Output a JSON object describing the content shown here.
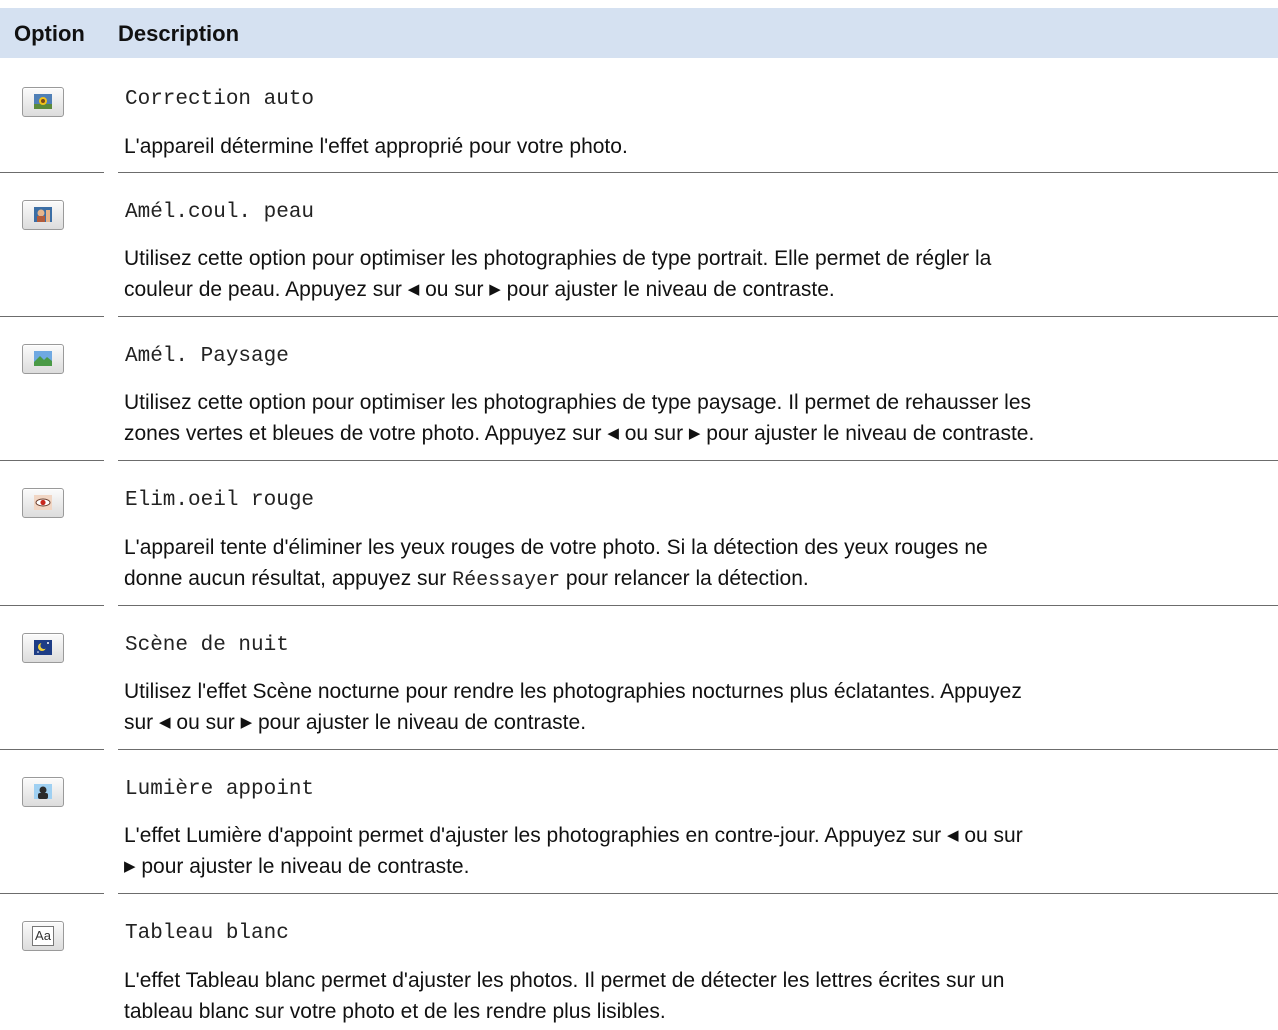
{
  "header": {
    "option": "Option",
    "description": "Description"
  },
  "rows": [
    {
      "icon": "sunflower-icon",
      "code": "Correction auto",
      "description": "L'appareil détermine l'effet approprié pour votre photo."
    },
    {
      "icon": "portrait-icon",
      "code": "Amél.coul. peau",
      "desc_line1": "Utilisez cette option pour optimiser les photographies de type portrait. Elle permet de régler la",
      "desc_line2_a": "couleur de peau. Appuyez sur ",
      "left_arrow": "◀",
      "desc_line2_b": " ou sur ",
      "right_arrow": "▶",
      "desc_line2_c": " pour ajuster le niveau de contraste."
    },
    {
      "icon": "landscape-icon",
      "code": "Amél. Paysage",
      "desc_line1": "Utilisez cette option pour optimiser les photographies de type paysage. Il permet de rehausser les",
      "desc_line2_a": "zones vertes et bleues de votre photo. Appuyez sur ",
      "left_arrow": "◀",
      "desc_line2_b": " ou sur ",
      "right_arrow": "▶",
      "desc_line2_c": " pour ajuster le niveau de contraste."
    },
    {
      "icon": "red-eye-icon",
      "code": "Elim.oeil rouge",
      "desc_line1": "L'appareil tente d'éliminer les yeux rouges de votre photo. Si la détection des yeux rouges ne",
      "desc_line2_a": "donne aucun résultat, appuyez sur ",
      "retry": "Réessayer",
      "desc_line2_b": " pour relancer la détection."
    },
    {
      "icon": "night-scene-icon",
      "code": "Scène de nuit",
      "desc_line1": "Utilisez l'effet Scène nocturne pour rendre les photographies nocturnes plus éclatantes. Appuyez",
      "desc_line2_a": "sur ",
      "left_arrow": "◀",
      "desc_line2_b": " ou sur ",
      "right_arrow": "▶",
      "desc_line2_c": " pour ajuster le niveau de contraste."
    },
    {
      "icon": "backlight-icon",
      "code": "Lumière appoint",
      "desc_line1_a": "L'effet Lumière d'appoint permet d'ajuster les photographies en contre-jour. Appuyez sur ",
      "left_arrow": "◀",
      "desc_line1_b": " ou sur",
      "right_arrow": "▶",
      "desc_line2": " pour ajuster le niveau de contraste."
    },
    {
      "icon": "whiteboard-aa-icon",
      "icon_text": "Aa",
      "code": "Tableau blanc",
      "desc_line1": "L'effet Tableau blanc permet d'ajuster les photos. Il permet de détecter les lettres écrites sur un",
      "desc_line2": "tableau blanc sur votre photo et de les rendre plus lisibles."
    }
  ]
}
